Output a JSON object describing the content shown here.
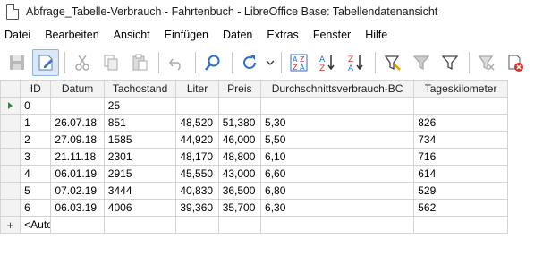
{
  "window": {
    "title": "Abfrage_Tabelle-Verbrauch - Fahrtenbuch - LibreOffice Base: Tabellendatenansicht"
  },
  "menu": [
    "Datei",
    "Bearbeiten",
    "Ansicht",
    "Einfügen",
    "Daten",
    "Extras",
    "Fenster",
    "Hilfe"
  ],
  "toolbar": {
    "icons": [
      "save-icon",
      "edit-icon",
      "cut-icon",
      "copy-icon",
      "paste-icon",
      "undo-icon",
      "find-icon",
      "refresh-icon",
      "sort-icon",
      "sort-ascending-icon",
      "sort-descending-icon",
      "autofilter-icon",
      "standard-filter-icon",
      "filter-icon",
      "remove-filter-icon",
      "delete-record-icon"
    ]
  },
  "table": {
    "columns": [
      "ID",
      "Datum",
      "Tachostand",
      "Liter",
      "Preis",
      "Durchschnittsverbrauch-BC",
      "Tageskilometer"
    ],
    "rows": [
      [
        "0",
        "",
        "25",
        "",
        "",
        "",
        ""
      ],
      [
        "1",
        "26.07.18",
        "851",
        "48,520",
        "51,380",
        "5,30",
        "826"
      ],
      [
        "2",
        "27.09.18",
        "1585",
        "44,920",
        "46,000",
        "5,50",
        "734"
      ],
      [
        "3",
        "21.11.18",
        "2301",
        "48,170",
        "48,800",
        "6,10",
        "716"
      ],
      [
        "4",
        "06.01.19",
        "2915",
        "45,550",
        "43,000",
        "6,60",
        "614"
      ],
      [
        "5",
        "07.02.19",
        "3444",
        "40,830",
        "36,500",
        "6,80",
        "529"
      ],
      [
        "6",
        "06.03.19",
        "4006",
        "39,360",
        "35,700",
        "6,30",
        "562"
      ]
    ],
    "new_row_placeholder": "<AutoField>"
  }
}
